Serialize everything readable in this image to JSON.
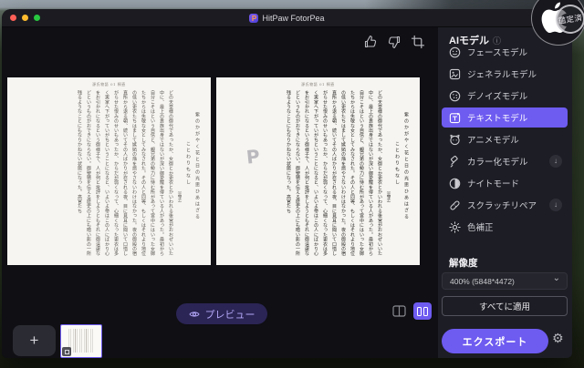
{
  "window": {
    "title": "HitPaw FotorPea",
    "logo_letter": "P"
  },
  "canvas": {
    "toolbar_icons": [
      "thumbs-up",
      "thumbs-down",
      "crop"
    ],
    "zoom_plus": "+",
    "zoom_minus": "−",
    "watermark_letter": "P",
    "page": {
      "header": "源氏物語 01 桐壺",
      "poem_line1": "紫のかがやく花と日の光思ひあはざる",
      "poem_line2": "ことわりもなし",
      "poem_author": "〔晶子〕",
      "body": "どの天皇様の御代であったか、女御とか更衣とかいわれる後宮がおおぜいいた中に、最上の貴族出身ではないが深い御愛寵を得ている人があった。最初から自分こそはという自信と、親兄弟の勢力に恃む所があって宮中にはいった女御たちからは失敬な女としてみなされた。その人と同等、もしくはそれより地位の低い更衣たちはまして嫉妬の焔を燃やさないわけはなかった。夜の御殿の宿直所から退る朝、続いてその人ばかりが召される夜、目に見耳に聞いて口惜しがらせた恨みのせいもあったか、からだが弱くなって、心細くなった更衣は多く実家へ下がっていがちということになると、いよいよ帝はこの人にばかり心をお引かれになるという御様子で、人が何と批評をしようともそれに御遠慮などというものがおできにならない。御聖徳を伝える歴史の上にも暗い影の一所残るようなことにもなりかねない状態になった。高官たち"
    },
    "preview_label": "プレビュー"
  },
  "sidebar": {
    "header": "AIモデル",
    "info_glyph": "ⓘ",
    "items": [
      {
        "label": "フェースモデル",
        "icon": "face-icon",
        "selected": false,
        "download": false
      },
      {
        "label": "ジェネラルモデル",
        "icon": "general-icon",
        "selected": false,
        "download": false
      },
      {
        "label": "デノイズモデル",
        "icon": "denoise-icon",
        "selected": false,
        "download": false
      },
      {
        "label": "テキストモデル",
        "icon": "text-icon",
        "selected": true,
        "download": false
      },
      {
        "label": "アニメモデル",
        "icon": "anime-icon",
        "selected": false,
        "download": false
      },
      {
        "label": "カラー化モデル",
        "icon": "colorize-icon",
        "selected": false,
        "download": true
      },
      {
        "label": "ナイトモード",
        "icon": "night-icon",
        "selected": false,
        "download": false
      },
      {
        "label": "スクラッチリペア",
        "icon": "scratch-icon",
        "selected": false,
        "download": true
      },
      {
        "label": "色補正",
        "icon": "color-correction-icon",
        "selected": false,
        "download": false
      }
    ],
    "download_glyph": "↓",
    "chevron_glyph": "⌄",
    "resolution_label": "解像度",
    "resolution_value": "400% (5848*4472)",
    "apply_all_label": "すべてに適用",
    "export_label": "エクスポート",
    "gear_glyph": "⚙"
  },
  "thumbnails": {
    "add_glyph": "+"
  },
  "badge": {
    "stamp_text": "鑑定済"
  },
  "colors": {
    "accent": "#6e5bf0",
    "traffic_close": "#ff5f57",
    "traffic_minimize": "#febc2e",
    "traffic_zoom": "#28c840",
    "panel_bg": "#1d1d25",
    "canvas_bg": "#0f0f14",
    "paper": "#f7f5f1"
  }
}
